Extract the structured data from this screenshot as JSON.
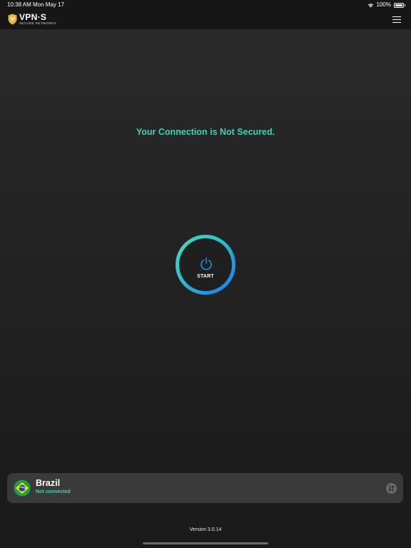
{
  "status_bar": {
    "time": "10:38 AM",
    "date": "Mon May 17",
    "battery": "100%"
  },
  "header": {
    "logo_title": "VPN·S",
    "logo_subtitle": "SECURE NETWORKS",
    "menu_icon": "hamburger-menu-icon"
  },
  "main": {
    "connection_status": "Your Connection is Not Secured.",
    "power_button_label": "START"
  },
  "location": {
    "country": "Brazil",
    "status": "Not connected",
    "flag_icon": "brazil-flag-icon",
    "action_icon": "switch-server-icon"
  },
  "footer": {
    "version": "Version 3.0.14"
  },
  "colors": {
    "accent_teal": "#3ed2b0",
    "accent_blue": "#1a7ff0",
    "logo_gold": "#f2b233",
    "card_bg": "#3a3a3a"
  }
}
